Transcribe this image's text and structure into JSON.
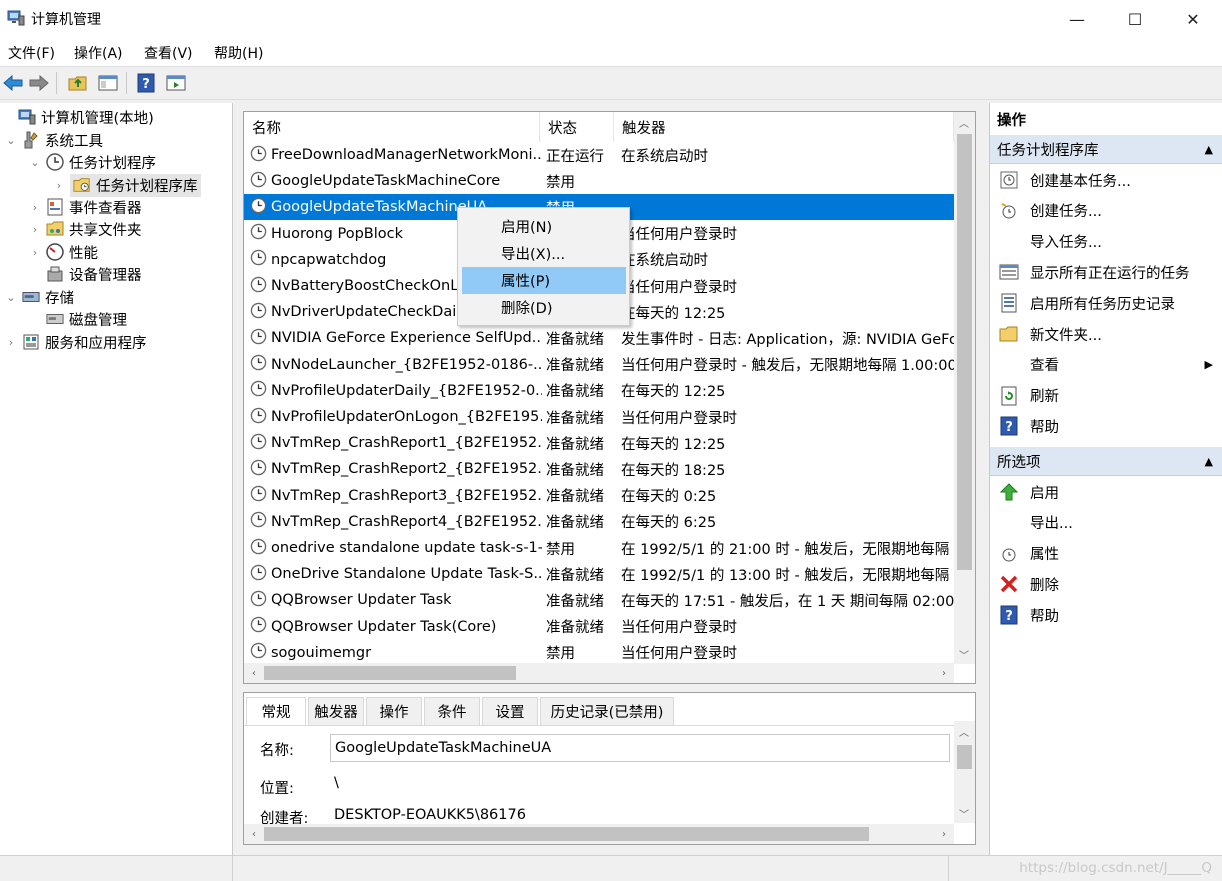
{
  "window": {
    "title": "计算机管理",
    "minimize": "—",
    "maximize": "☐",
    "close": "✕"
  },
  "menu": [
    "文件(F)",
    "操作(A)",
    "查看(V)",
    "帮助(H)"
  ],
  "tree": [
    {
      "label": "计算机管理(本地)",
      "icon": "computer-management-icon"
    },
    {
      "label": "系统工具",
      "icon": "system-tools-icon"
    },
    {
      "label": "任务计划程序",
      "icon": "task-scheduler-icon"
    },
    {
      "label": "任务计划程序库",
      "icon": "folder-clock-icon"
    },
    {
      "label": "事件查看器",
      "icon": "event-viewer-icon"
    },
    {
      "label": "共享文件夹",
      "icon": "shared-folders-icon"
    },
    {
      "label": "性能",
      "icon": "performance-icon"
    },
    {
      "label": "设备管理器",
      "icon": "device-manager-icon"
    },
    {
      "label": "存储",
      "icon": "storage-icon"
    },
    {
      "label": "磁盘管理",
      "icon": "disk-management-icon"
    },
    {
      "label": "服务和应用程序",
      "icon": "services-icon"
    }
  ],
  "list": {
    "columns": [
      "名称",
      "状态",
      "触发器"
    ],
    "rows": [
      {
        "name": "FreeDownloadManagerNetworkMoni...",
        "status": "正在运行",
        "trigger": "在系统启动时"
      },
      {
        "name": "GoogleUpdateTaskMachineCore",
        "status": "禁用",
        "trigger": ""
      },
      {
        "name": "GoogleUpdateTaskMachineUA",
        "status": "禁用",
        "trigger": ""
      },
      {
        "name": "Huorong PopBlock",
        "status": "",
        "trigger": "当任何用户登录时"
      },
      {
        "name": "npcapwatchdog",
        "status": "",
        "trigger": "在系统启动时"
      },
      {
        "name": "NvBatteryBoostCheckOnLo",
        "status": "",
        "trigger": "当任何用户登录时"
      },
      {
        "name": "NvDriverUpdateCheckDaily",
        "status": "",
        "trigger": "在每天的 12:25"
      },
      {
        "name": "NVIDIA GeForce Experience SelfUpd...",
        "status": "准备就绪",
        "trigger": "发生事件时 - 日志: Application，源: NVIDIA GeFo"
      },
      {
        "name": "NvNodeLauncher_{B2FE1952-0186-...",
        "status": "准备就绪",
        "trigger": "当任何用户登录时 - 触发后，无限期地每隔 1.00:00"
      },
      {
        "name": "NvProfileUpdaterDaily_{B2FE1952-0...",
        "status": "准备就绪",
        "trigger": "在每天的 12:25"
      },
      {
        "name": "NvProfileUpdaterOnLogon_{B2FE195...",
        "status": "准备就绪",
        "trigger": "当任何用户登录时"
      },
      {
        "name": "NvTmRep_CrashReport1_{B2FE1952...",
        "status": "准备就绪",
        "trigger": "在每天的 12:25"
      },
      {
        "name": "NvTmRep_CrashReport2_{B2FE1952...",
        "status": "准备就绪",
        "trigger": "在每天的 18:25"
      },
      {
        "name": "NvTmRep_CrashReport3_{B2FE1952...",
        "status": "准备就绪",
        "trigger": "在每天的 0:25"
      },
      {
        "name": "NvTmRep_CrashReport4_{B2FE1952...",
        "status": "准备就绪",
        "trigger": "在每天的 6:25"
      },
      {
        "name": "onedrive standalone update task-s-1-...",
        "status": "禁用",
        "trigger": "在 1992/5/1 的 21:00 时 - 触发后，无限期地每隔"
      },
      {
        "name": "OneDrive Standalone Update Task-S...",
        "status": "准备就绪",
        "trigger": "在 1992/5/1 的 13:00 时 - 触发后，无限期地每隔"
      },
      {
        "name": "QQBrowser Updater Task",
        "status": "准备就绪",
        "trigger": "在每天的 17:51 - 触发后，在 1 天 期间每隔 02:00:"
      },
      {
        "name": "QQBrowser Updater Task(Core)",
        "status": "准备就绪",
        "trigger": "当任何用户登录时"
      },
      {
        "name": "sogouimemgr",
        "status": "禁用",
        "trigger": "当任何用户登录时"
      }
    ]
  },
  "context_menu": [
    "启用(N)",
    "导出(X)...",
    "属性(P)",
    "删除(D)"
  ],
  "detail": {
    "tabs": [
      "常规",
      "触发器",
      "操作",
      "条件",
      "设置",
      "历史记录(已禁用)"
    ],
    "fields": [
      {
        "label": "名称:",
        "value": "GoogleUpdateTaskMachineUA"
      },
      {
        "label": "位置:",
        "value": "\\"
      },
      {
        "label": "创建者:",
        "value": "DESKTOP-EOAUKK5\\86176"
      }
    ]
  },
  "actions": {
    "header": "操作",
    "section1": {
      "title": "任务计划程序库",
      "items": [
        {
          "label": "创建基本任务...",
          "icon": "create-basic-task-icon"
        },
        {
          "label": "创建任务...",
          "icon": "create-task-icon"
        },
        {
          "label": "导入任务...",
          "icon": ""
        },
        {
          "label": "显示所有正在运行的任务",
          "icon": "running-tasks-icon"
        },
        {
          "label": "启用所有任务历史记录",
          "icon": "history-icon"
        },
        {
          "label": "新文件夹...",
          "icon": "new-folder-icon"
        },
        {
          "label": "查看",
          "icon": ""
        },
        {
          "label": "刷新",
          "icon": "refresh-icon"
        },
        {
          "label": "帮助",
          "icon": "help-icon"
        }
      ]
    },
    "section2": {
      "title": "所选项",
      "items": [
        {
          "label": "启用",
          "icon": "enable-arrow-icon"
        },
        {
          "label": "导出...",
          "icon": ""
        },
        {
          "label": "属性",
          "icon": "properties-icon"
        },
        {
          "label": "删除",
          "icon": "delete-icon"
        },
        {
          "label": "帮助",
          "icon": "help-icon"
        }
      ]
    }
  },
  "watermark": "https://blog.csdn.net/J_____Q",
  "colors": {
    "selection": "#0078d7",
    "menu_hover": "#91c9f7",
    "section_header": "#dde6f3"
  }
}
